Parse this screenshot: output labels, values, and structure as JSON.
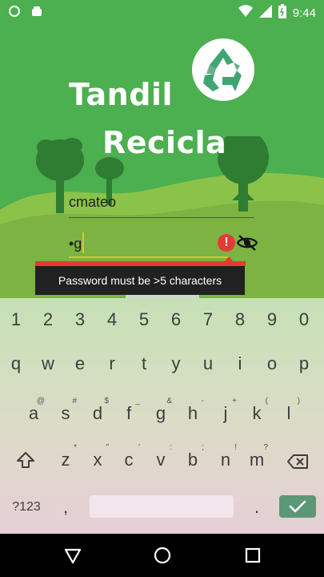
{
  "status_bar": {
    "time": "9:44",
    "left_icons": [
      "notification-dot-icon",
      "android-icon"
    ],
    "right_icons": [
      "wifi-icon",
      "signal-icon",
      "battery-icon"
    ]
  },
  "app": {
    "title_line1": "Tandil",
    "title_line2": "Recicla",
    "logo": "recycle-logo-icon",
    "username_value": "cmateo",
    "password_value": "•g",
    "error_message": "Password must be >5 characters",
    "icons": [
      "error-icon",
      "visibility-off-icon"
    ]
  },
  "keyboard": {
    "number_row": [
      "1",
      "2",
      "3",
      "4",
      "5",
      "6",
      "7",
      "8",
      "9",
      "0"
    ],
    "row1": [
      {
        "k": "q",
        "h": ""
      },
      {
        "k": "w",
        "h": ""
      },
      {
        "k": "e",
        "h": ""
      },
      {
        "k": "r",
        "h": ""
      },
      {
        "k": "t",
        "h": ""
      },
      {
        "k": "y",
        "h": ""
      },
      {
        "k": "u",
        "h": ""
      },
      {
        "k": "i",
        "h": ""
      },
      {
        "k": "o",
        "h": ""
      },
      {
        "k": "p",
        "h": ""
      }
    ],
    "row2": [
      {
        "k": "a",
        "h": "@"
      },
      {
        "k": "s",
        "h": "#"
      },
      {
        "k": "d",
        "h": "$"
      },
      {
        "k": "f",
        "h": "_"
      },
      {
        "k": "g",
        "h": "&"
      },
      {
        "k": "h",
        "h": "-"
      },
      {
        "k": "j",
        "h": "+"
      },
      {
        "k": "k",
        "h": "("
      },
      {
        "k": "l",
        "h": ")"
      }
    ],
    "row3": [
      {
        "k": "z",
        "h": "*"
      },
      {
        "k": "x",
        "h": "\""
      },
      {
        "k": "c",
        "h": "'"
      },
      {
        "k": "v",
        "h": ":"
      },
      {
        "k": "b",
        "h": ";"
      },
      {
        "k": "n",
        "h": "!"
      },
      {
        "k": "m",
        "h": "?"
      }
    ],
    "symbols_label": "?123",
    "comma": ",",
    "period": "."
  },
  "nav_bar": {
    "buttons": [
      "back-icon",
      "home-icon",
      "recents-icon"
    ]
  },
  "colors": {
    "app_green": "#4caf50",
    "error_red": "#e53935",
    "accent_yellow": "#e6c22a",
    "enter_key": "#5b9877"
  }
}
